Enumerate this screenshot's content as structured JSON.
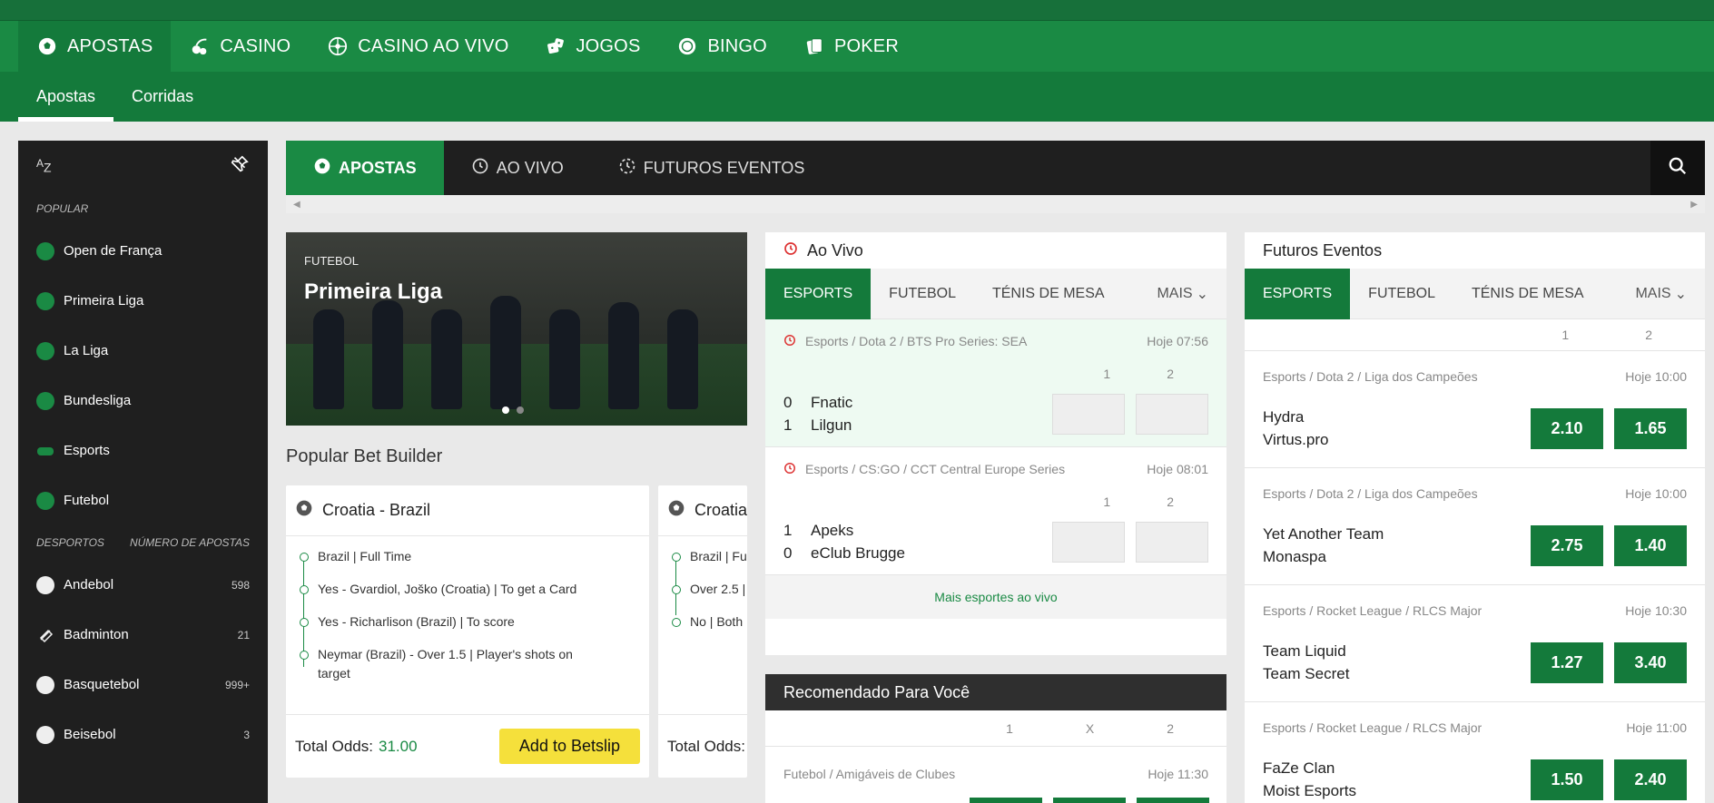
{
  "main_nav": [
    {
      "label": "APOSTAS",
      "icon": "soccer-ball-icon",
      "active": true
    },
    {
      "label": "CASINO",
      "icon": "cherries-icon",
      "active": false
    },
    {
      "label": "CASINO AO VIVO",
      "icon": "roulette-icon",
      "active": false
    },
    {
      "label": "JOGOS",
      "icon": "dice-icon",
      "active": false
    },
    {
      "label": "BINGO",
      "icon": "bingo-ball-icon",
      "active": false
    },
    {
      "label": "POKER",
      "icon": "cards-icon",
      "active": false
    }
  ],
  "sub_nav": [
    {
      "label": "Apostas",
      "active": true
    },
    {
      "label": "Corridas",
      "active": false
    }
  ],
  "sidebar": {
    "az_label": {
      "a": "A",
      "z": "Z"
    },
    "popular_heading": "POPULAR",
    "popular": [
      {
        "label": "Open de França",
        "icon": "tennis-ball-icon"
      },
      {
        "label": "Primeira Liga",
        "icon": "soccer-ball-icon"
      },
      {
        "label": "La Liga",
        "icon": "soccer-ball-icon"
      },
      {
        "label": "Bundesliga",
        "icon": "soccer-ball-icon"
      },
      {
        "label": "Esports",
        "icon": "gamepad-icon"
      },
      {
        "label": "Futebol",
        "icon": "soccer-ball-icon"
      }
    ],
    "sports_heading": "DESPORTOS",
    "count_heading": "NÚMERO DE APOSTAS",
    "sports": [
      {
        "label": "Andebol",
        "count": "598",
        "icon": "handball-icon"
      },
      {
        "label": "Badminton",
        "count": "21",
        "icon": "shuttlecock-icon"
      },
      {
        "label": "Basquetebol",
        "count": "999+",
        "icon": "basketball-icon"
      },
      {
        "label": "Beisebol",
        "count": "3",
        "icon": "baseball-icon"
      }
    ]
  },
  "center_tabs": [
    {
      "label": "APOSTAS",
      "icon": "soccer-ball-icon",
      "active": true
    },
    {
      "label": "AO VIVO",
      "icon": "clock-icon",
      "active": false
    },
    {
      "label": "FUTUROS EVENTOS",
      "icon": "refresh-clock-icon",
      "active": false
    }
  ],
  "banner": {
    "category": "FUTEBOL",
    "title": "Primeira Liga"
  },
  "bet_builder": {
    "title": "Popular Bet Builder",
    "cards": [
      {
        "match": "Croatia - Brazil",
        "legs": [
          "Brazil | Full Time",
          "Yes - Gvardiol, Joško (Croatia) | To get a Card",
          "Yes - Richarlison (Brazil) | To score",
          "Neymar (Brazil) - Over 1.5 | Player's shots on target"
        ],
        "total_label": "Total Odds:",
        "total_odds": "31.00",
        "add_label": "Add to Betslip"
      },
      {
        "match": "Croatia",
        "legs": [
          "Brazil | Fu",
          "Over 2.5 |",
          "No | Both"
        ],
        "total_label": "Total Odds:"
      }
    ]
  },
  "live": {
    "title": "Ao Vivo",
    "filters": [
      "ESPORTS",
      "FUTEBOL",
      "TÉNIS DE MESA"
    ],
    "more": "MAIS",
    "events": [
      {
        "path": "Esports / Dota 2 / BTS Pro Series: SEA",
        "time": "Hoje 07:56",
        "h1": "1",
        "h2": "2",
        "teams": [
          {
            "score": "0",
            "name": "Fnatic"
          },
          {
            "score": "1",
            "name": "Lilgun"
          }
        ]
      },
      {
        "path": "Esports / CS:GO / CCT Central Europe Series",
        "time": "Hoje 08:01",
        "h1": "1",
        "h2": "2",
        "teams": [
          {
            "score": "1",
            "name": "Apeks"
          },
          {
            "score": "0",
            "name": "eClub Brugge"
          }
        ]
      }
    ],
    "more_link": "Mais esportes ao vivo"
  },
  "recommended": {
    "title": "Recomendado Para Você",
    "cols": [
      "1",
      "X",
      "2"
    ],
    "event": {
      "path": "Futebol / Amigáveis de Clubes",
      "time": "Hoje 11:30"
    }
  },
  "futures": {
    "title": "Futuros Eventos",
    "filters": [
      "ESPORTS",
      "FUTEBOL",
      "TÉNIS DE MESA"
    ],
    "more": "MAIS",
    "cols": [
      "1",
      "2"
    ],
    "events": [
      {
        "path": "Esports / Dota 2 / Liga dos Campeões",
        "time": "Hoje 10:00",
        "t1": "Hydra",
        "t2": "Virtus.pro",
        "o1": "2.10",
        "o2": "1.65"
      },
      {
        "path": "Esports / Dota 2 / Liga dos Campeões",
        "time": "Hoje 10:00",
        "t1": "Yet Another Team",
        "t2": "Monaspa",
        "o1": "2.75",
        "o2": "1.40"
      },
      {
        "path": "Esports / Rocket League / RLCS Major",
        "time": "Hoje 10:30",
        "t1": "Team Liquid",
        "t2": "Team Secret",
        "o1": "1.27",
        "o2": "3.40"
      },
      {
        "path": "Esports / Rocket League / RLCS Major",
        "time": "Hoje 11:00",
        "t1": "FaZe Clan",
        "t2": "Moist Esports",
        "o1": "1.50",
        "o2": "2.40"
      }
    ]
  },
  "colors": {
    "brand_green": "#1a8a44",
    "dark_green": "#147a3b",
    "sidebar_bg": "#1f1f1f",
    "cta_yellow": "#f5e03b"
  }
}
